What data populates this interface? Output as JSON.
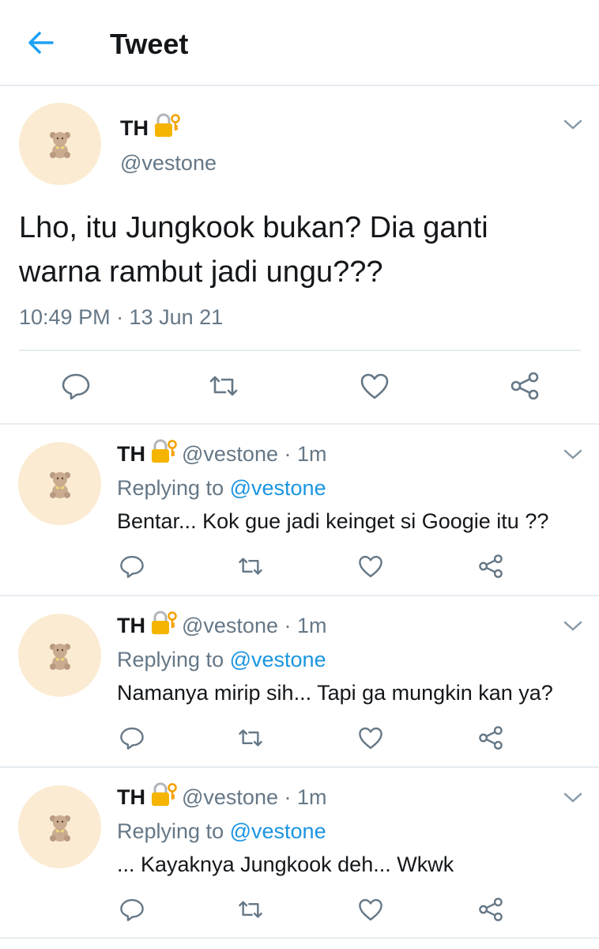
{
  "header": {
    "title": "Tweet",
    "back_icon": "arrow-left-icon",
    "accent_color": "#1da1f2"
  },
  "main_tweet": {
    "name": "TH",
    "handle": "@vestone",
    "protected_icon": "lock-key-icon",
    "text_line1": "Lho, itu Jungkook bukan? Dia ganti",
    "text_line2": "warna rambut jadi ungu???",
    "timestamp": "10:49 PM · 13 Jun 21",
    "actions": [
      "reply-icon",
      "retweet-icon",
      "like-icon",
      "share-icon"
    ]
  },
  "replies": [
    {
      "name": "TH",
      "handle": "@vestone · 1m",
      "replying_label": "Replying to",
      "replying_to": "@vestone",
      "text": "Bentar... Kok gue jadi keinget si Googie itu ??"
    },
    {
      "name": "TH",
      "handle": "@vestone · 1m",
      "replying_label": "Replying to",
      "replying_to": "@vestone",
      "text": "Namanya mirip sih... Tapi ga mungkin kan ya?"
    },
    {
      "name": "TH",
      "handle": "@vestone · 1m",
      "replying_label": "Replying to",
      "replying_to": "@vestone",
      "text": "... Kayaknya Jungkook deh... Wkwk"
    }
  ],
  "colors": {
    "secondary_text": "#657786",
    "mention": "#1b95e0",
    "divider": "#e6ecf0",
    "avatar_bg": "#faebd2"
  }
}
